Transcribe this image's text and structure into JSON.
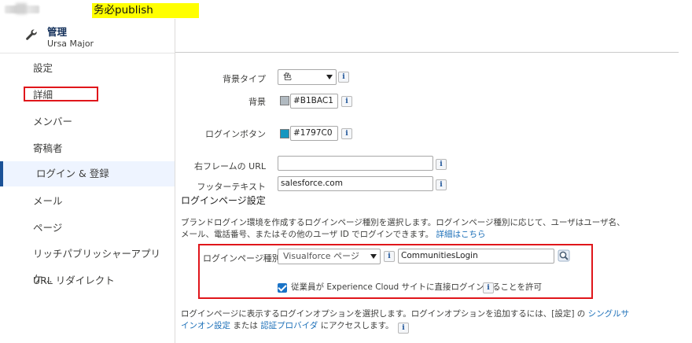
{
  "banner": {
    "note": "务必publish"
  },
  "sidebar": {
    "title": "管理",
    "subtitle": "Ursa Major",
    "items": [
      {
        "label": "設定"
      },
      {
        "label": "詳細"
      },
      {
        "label": "メンバー"
      },
      {
        "label": "寄稿者"
      },
      {
        "label": "ログイン & 登録"
      },
      {
        "label": "メール"
      },
      {
        "label": "ページ"
      },
      {
        "label": "リッチパブリッシャーアプリケ..."
      },
      {
        "label": "URL リダイレクト"
      }
    ],
    "active_index": 4
  },
  "form": {
    "background_type": {
      "label": "背景タイプ",
      "value": "色"
    },
    "background": {
      "label": "背景",
      "value": "#B1BAC1",
      "color": "#B1BAC1"
    },
    "login_button": {
      "label": "ログインボタン",
      "value": "#1797C0",
      "color": "#1797C0"
    },
    "right_frame_url": {
      "label": "右フレームの URL",
      "value": ""
    },
    "footer_text": {
      "label": "フッターテキスト",
      "value": "salesforce.com"
    }
  },
  "login_page": {
    "section_title": "ログインページ設定",
    "description": "ブランドログイン環境を作成するログインページ種別を選択します。ログインページ種別に応じて、ユーザはユーザ名、メール、電話番号、またはその他のユーザ ID でログインできます。",
    "details_link": "詳細はこちら",
    "type_label": "ログインページ種別",
    "type_value": "Visualforce ページ",
    "page_name": "CommunitiesLogin",
    "allow_employee_label": "従業員が Experience Cloud サイトに直接ログインすることを許可",
    "allow_employee_checked": true,
    "bottom_text_1": "ログインページに表示するログインオプションを選択します。ログインオプションを追加するには、[設定] の",
    "sso_link": "シングルサインオン設定",
    "bottom_or": "または",
    "auth_link": "認証プロバイダ",
    "bottom_text_2": "にアクセスします。"
  },
  "icons": {
    "info": "i"
  },
  "colors": {
    "accent": "#1b5297",
    "link": "#1b6fb8",
    "highlight": "#e0161b"
  }
}
